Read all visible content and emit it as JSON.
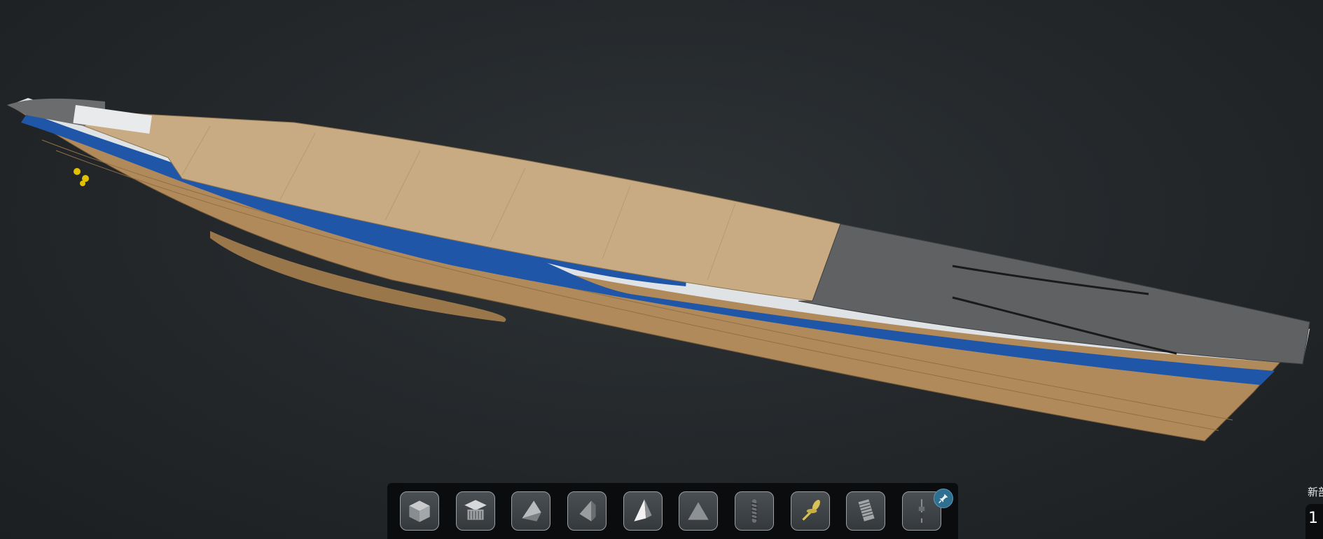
{
  "viewport": {
    "model": "ship-model",
    "background": "#25292c"
  },
  "colors": {
    "deck": "#c9ab83",
    "hull": "#b08a5a",
    "stripe_blue": "#1f56a8",
    "stripe_white": "#dfe3e6",
    "foredeck": "#5f6163"
  },
  "toolbar": {
    "tools": [
      {
        "name": "cube-view-icon"
      },
      {
        "name": "building-view-icon"
      },
      {
        "name": "wedge-view-icon"
      },
      {
        "name": "side-view-icon"
      },
      {
        "name": "pyramid-view-icon"
      },
      {
        "name": "triangle-view-icon"
      },
      {
        "name": "spring-icon"
      },
      {
        "name": "propeller-icon"
      },
      {
        "name": "stairs-icon"
      },
      {
        "name": "mast-icon"
      }
    ],
    "pin_icon": "pin-icon"
  },
  "corner": {
    "label": "新部",
    "value": "1"
  }
}
